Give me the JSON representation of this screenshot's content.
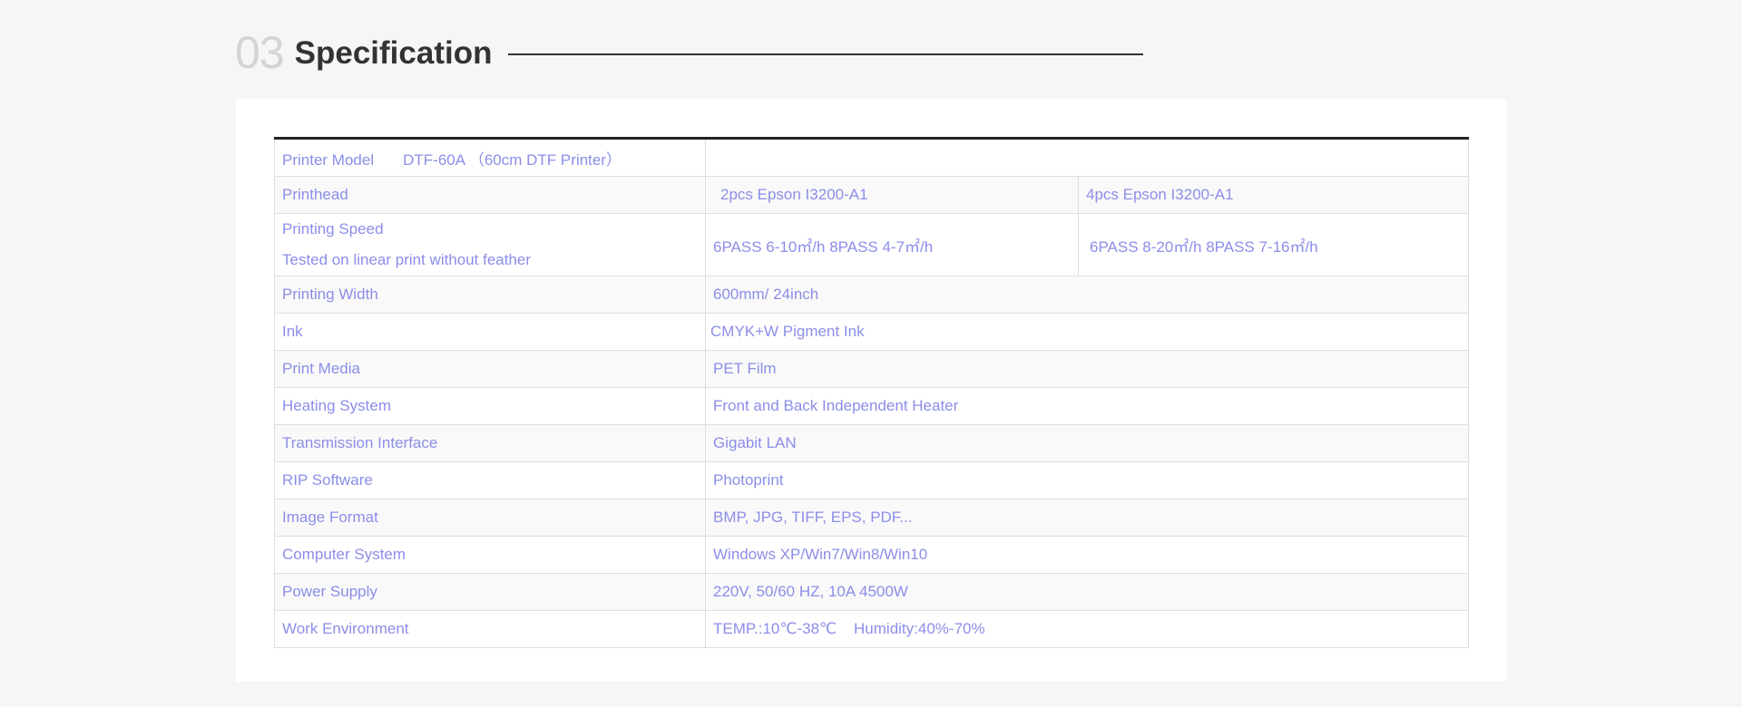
{
  "section": {
    "number": "03",
    "title": "Specification"
  },
  "spec": {
    "model_label": "Printer Model",
    "model_value": "DTF-60A （60cm DTF Printer）",
    "rows": [
      {
        "label": "Printhead",
        "value_a": "2pcs Epson I3200-A1",
        "value_b": "4pcs Epson I3200-A1"
      },
      {
        "label": "Printing Speed",
        "label_sub": "Tested on linear print without feather",
        "value_a": "6PASS 6-10㎡/h  8PASS 4-7㎡/h",
        "value_b": "6PASS 8-20㎡/h  8PASS 7-16㎡/h"
      },
      {
        "label": "Printing Width",
        "value": "600mm/ 24inch"
      },
      {
        "label": "Ink",
        "value": "CMYK+W  Pigment Ink"
      },
      {
        "label": "Print Media",
        "value": "PET Film"
      },
      {
        "label": "Heating System",
        "value": "Front and Back Independent Heater"
      },
      {
        "label": "Transmission Interface",
        "value": "Gigabit LAN"
      },
      {
        "label": "RIP Software",
        "value": "Photoprint"
      },
      {
        "label": "Image Format",
        "value": "BMP, JPG, TIFF, EPS, PDF..."
      },
      {
        "label": "Computer System",
        "value": "Windows XP/Win7/Win8/Win10"
      },
      {
        "label": "Power Supply",
        "value": "220V, 50/60 HZ, 10A 4500W"
      },
      {
        "label": "Work Environment",
        "value": "TEMP.:10℃-38℃    Humidity:40%-70%"
      }
    ]
  },
  "colors": {
    "text": "#8b8ee8",
    "heading": "#333333",
    "number": "#d4d4d4",
    "background": "#f6f6f6"
  }
}
